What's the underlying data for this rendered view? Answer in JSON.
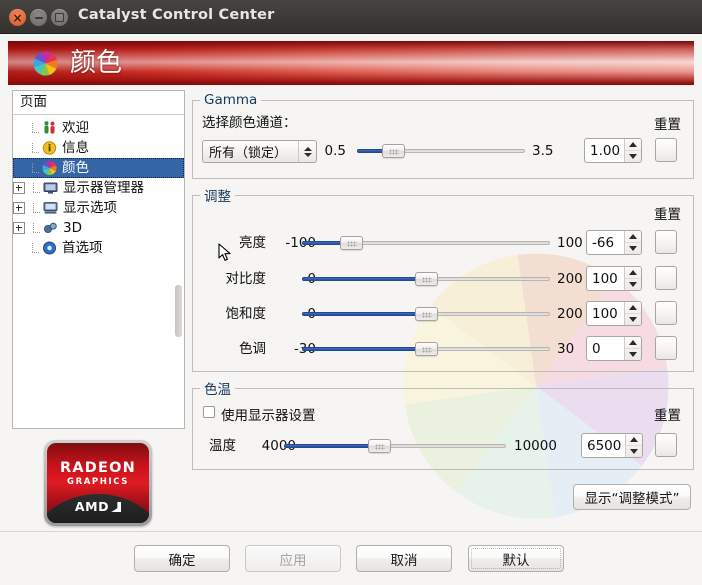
{
  "window": {
    "title": "Catalyst Control Center",
    "controls": {
      "close": "close-button",
      "minimize": "minimize-button",
      "maximize": "maximize-button"
    }
  },
  "banner": {
    "title": "颜色",
    "icon": "color-wheel-icon",
    "accent": "#b01510"
  },
  "sidebar": {
    "header": "页面",
    "items": [
      {
        "label": "欢迎",
        "icon": "welcome-icon",
        "expandable": false,
        "selected": false
      },
      {
        "label": "信息",
        "icon": "info-icon",
        "expandable": false,
        "selected": false
      },
      {
        "label": "颜色",
        "icon": "color-icon",
        "expandable": false,
        "selected": true
      },
      {
        "label": "显示器管理器",
        "icon": "monitor-icon",
        "expandable": true,
        "selected": false
      },
      {
        "label": "显示选项",
        "icon": "display-icon",
        "expandable": true,
        "selected": false
      },
      {
        "label": "3D",
        "icon": "cube-3d-icon",
        "expandable": true,
        "selected": false
      },
      {
        "label": "首选项",
        "icon": "preferences-icon",
        "expandable": false,
        "selected": false
      }
    ]
  },
  "logo": {
    "brand": "RADEON",
    "sub": "GRAPHICS",
    "vendor": "AMD"
  },
  "gamma": {
    "legend": "Gamma",
    "channel_label": "选择颜色通道：",
    "channel_value": "所有（锁定）",
    "reset_header": "重置",
    "slider": {
      "min": "0.5",
      "max": "3.5",
      "value": "1.00",
      "fill_percent": 17,
      "thumb_percent": 17
    },
    "spin_value": "1.00"
  },
  "adjust": {
    "legend": "调整",
    "reset_header": "重置",
    "rows": [
      {
        "name": "亮度",
        "min": "-100",
        "max": "100",
        "value": "-66",
        "fill_percent": 17,
        "thumb_percent": 17
      },
      {
        "name": "对比度",
        "min": "0",
        "max": "200",
        "value": "100",
        "fill_percent": 50,
        "thumb_percent": 50
      },
      {
        "name": "饱和度",
        "min": "0",
        "max": "200",
        "value": "100",
        "fill_percent": 50,
        "thumb_percent": 50
      },
      {
        "name": "色调",
        "min": "-30",
        "max": "30",
        "value": "0",
        "fill_percent": 50,
        "thumb_percent": 50
      }
    ]
  },
  "temperature": {
    "legend": "色温",
    "checkbox_label": "使用显示器设置",
    "checkbox_checked": false,
    "reset_header": "重置",
    "row": {
      "name": "温度",
      "min": "4000",
      "max": "10000",
      "value": "6500",
      "fill_percent": 42,
      "thumb_percent": 42
    }
  },
  "show_mode_button": "显示“调整模式”",
  "footer": {
    "ok": "确定",
    "apply": "应用",
    "apply_disabled": true,
    "cancel": "取消",
    "defaults": "默认"
  }
}
